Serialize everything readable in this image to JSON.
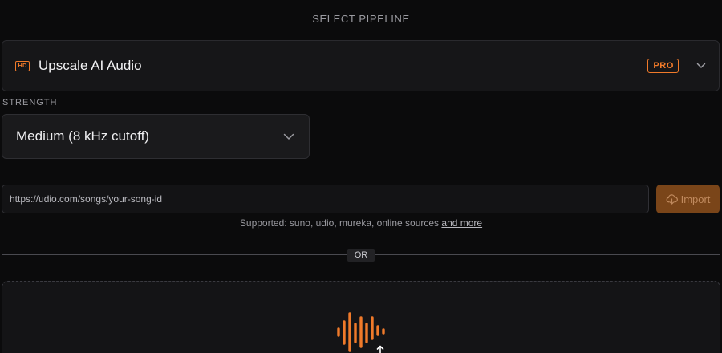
{
  "section_title": "SELECT PIPELINE",
  "pipeline": {
    "icon": "hd-icon",
    "icon_text": "HD",
    "name": "Upscale AI Audio",
    "badge": "PRO",
    "expand_icon": "chevron-down-icon"
  },
  "strength": {
    "label": "STRENGTH",
    "selected": "Medium (8 kHz cutoff)",
    "expand_icon": "chevron-down-icon"
  },
  "import": {
    "url_placeholder": "https://udio.com/songs/your-song-id",
    "url_value": "",
    "button_label": "Import",
    "button_icon": "cloud-download-icon",
    "supported_text": "Supported: suno, udio, mureka, online sources",
    "more_link": "and more"
  },
  "divider_label": "OR",
  "dropzone": {
    "icon": "audio-waveform-upload-icon"
  },
  "colors": {
    "accent": "#f07a2a",
    "background": "#0b0b0c",
    "panel": "#161618",
    "import_button": "#7a4519"
  }
}
